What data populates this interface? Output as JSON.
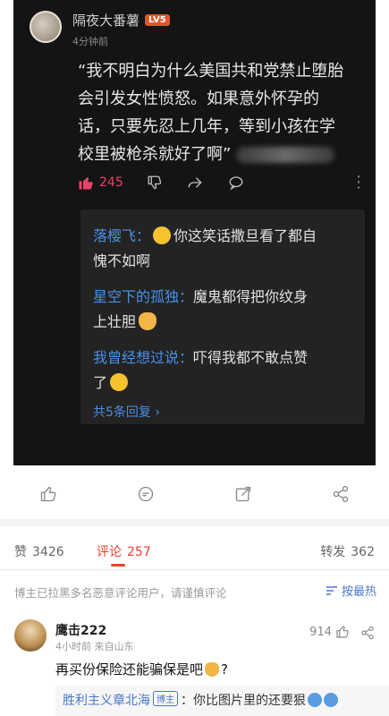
{
  "post_screenshot": {
    "author": "隔夜大番薯",
    "level_badge": "LV5",
    "time": "4分钟前",
    "quote_lines": [
      "“我不明白为什么美国共和党禁止堕胎",
      "会引发女性愤怒。如果意外怀孕的",
      "话，只要先忍上几年，等到小孩在学",
      "校里被枪杀就好了啊”"
    ],
    "like_count": "245",
    "replies": [
      {
        "who": "落樱飞：",
        "emoji": "laugh-emoji",
        "text1": "你这笑话撒旦看了都自",
        "text2": "愧不如啊"
      },
      {
        "who": "星空下的孤独：",
        "text1": "魔鬼都得把你纹身",
        "text2": "上壮胆",
        "emoji": "cat-emoji"
      },
      {
        "who": "我曾经想过说：",
        "text1": "吓得我都不敢点赞",
        "text2": "了",
        "emoji": "laugh-cry-emoji"
      }
    ],
    "more_replies": "共5条回复 ›"
  },
  "tabs": {
    "repost_label": "赞",
    "repost_count": "3426",
    "comment_label": "评论",
    "comment_count": "257",
    "forward_label": "转发",
    "forward_count": "362"
  },
  "notice": "博主已拉黑多名恶意评论用户，请谨慎评论",
  "sort_label": "按最热",
  "comment": {
    "name": "鹰击222",
    "meta": "4小时前  来自山东",
    "like_count": "914",
    "text": "再买份保险还能骗保是吧",
    "text_tail": "?",
    "subreply_who": "胜利主义章北海",
    "subreply_tag": "博主",
    "subreply_text": "：你比图片里的还要狠"
  },
  "colors": {
    "accent_red": "#e8402e",
    "link_blue": "#4a78c8",
    "like_pink": "#e8416a"
  }
}
